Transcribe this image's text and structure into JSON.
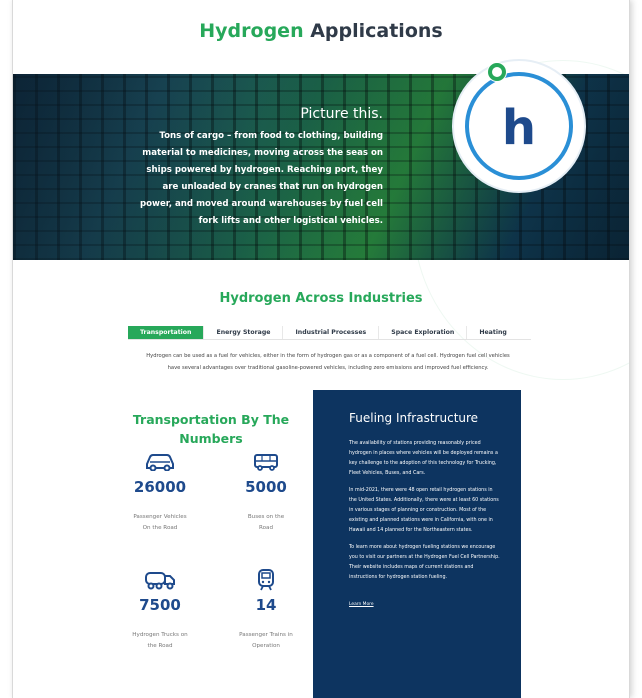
{
  "header": {
    "title_accent": "Hydrogen",
    "title_rest": " Applications"
  },
  "hero": {
    "heading": "Picture this.",
    "body": "Tons of cargo – from food to clothing, building material to medicines, moving across the seas on ships powered by hydrogen. Reaching port, they are unloaded by cranes that run on hydrogen power, and moved around warehouses by fuel cell fork lifts and other logistical vehicles.",
    "logo_letter": "h"
  },
  "industries": {
    "title": "Hydrogen Across Industries",
    "tabs": [
      {
        "label": "Transportation",
        "active": true
      },
      {
        "label": "Energy Storage",
        "active": false
      },
      {
        "label": "Industrial Processes",
        "active": false
      },
      {
        "label": "Space Exploration",
        "active": false
      },
      {
        "label": "Heating",
        "active": false
      }
    ],
    "intro": "Hydrogen can be used as a fuel for vehicles, either in the form of hydrogen gas or as a component of a fuel cell. Hydrogen fuel cell vehicles have several advantages over traditional gasoline-powered vehicles, including zero emissions and improved fuel efficiency."
  },
  "stats": {
    "title": "Transportation By The Numbers",
    "items": [
      {
        "value": "26000",
        "label": "Passenger Vehicles On the Road",
        "icon": "car-icon"
      },
      {
        "value": "5000",
        "label": "Buses on the Road",
        "icon": "bus-icon"
      },
      {
        "value": "7500",
        "label": "Hydrogen Trucks on the Road",
        "icon": "truck-icon"
      },
      {
        "value": "14",
        "label": "Passenger Trains in Operation",
        "icon": "train-icon"
      }
    ]
  },
  "fueling": {
    "title": "Fueling Infrastructure",
    "p1": "The availability of stations providing reasonably priced hydrogen in places where vehicles will be deployed remains a key challenge to the adoption of this technology for Trucking, Fleet Vehicles, Buses, and Cars.",
    "p2": "In mid-2021, there were 48 open retail hydrogen stations in the United States. Additionally, there were at least 60 stations in various stages of planning or construction. Most of the existing and planned stations were in California, with one in Hawaii and 14 planned for the Northeastern states.",
    "p3": "To learn more about hydrogen fueling stations we encourage you to visit our partners at the Hydrogen Fuel Cell Partnership. Their website includes maps of current stations and instructions for hydrogen station fueling.",
    "link": "Learn More"
  },
  "colors": {
    "accent_green": "#27a85a",
    "navy": "#0d3460",
    "number_blue": "#1e4a8c",
    "logo_blue": "#2a8fd6"
  }
}
